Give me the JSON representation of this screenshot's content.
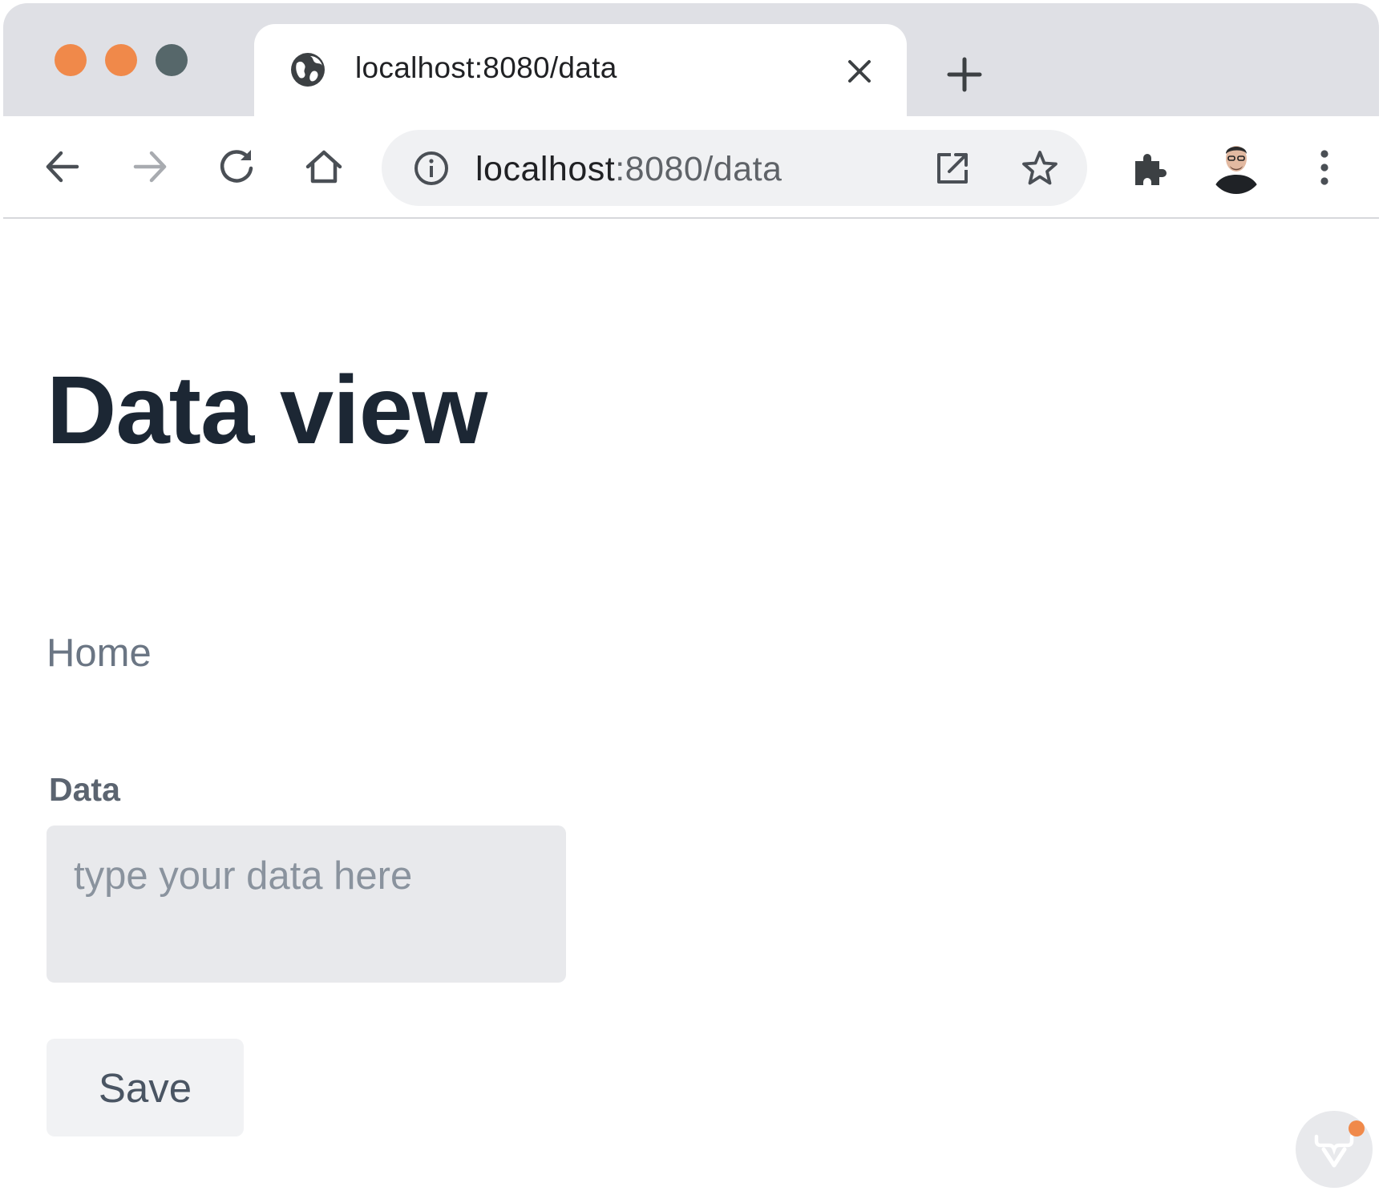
{
  "browser": {
    "traffic_lights": {
      "close_color": "#f0894a",
      "minimize_color": "#f0894a",
      "maximize_color": "#56676a"
    },
    "tab": {
      "title": "localhost:8080/data",
      "favicon": "globe-icon",
      "close_icon": "close-icon"
    },
    "new_tab_icon": "plus-icon",
    "toolbar": {
      "back_icon": "arrow-left-icon",
      "forward_icon": "arrow-right-icon",
      "reload_icon": "reload-icon",
      "home_icon": "home-icon",
      "site_info_icon": "info-icon",
      "address_host": "localhost",
      "address_rest": ":8080/data",
      "open_external_icon": "open-in-new-icon",
      "bookmark_icon": "star-icon",
      "extensions_icon": "puzzle-icon",
      "profile_icon": "avatar",
      "menu_icon": "more-vert-icon"
    }
  },
  "page": {
    "title": "Data view",
    "home_link": "Home",
    "data_field": {
      "label": "Data",
      "placeholder": "type your data here",
      "value": ""
    },
    "save_button": "Save"
  },
  "dev_badge": {
    "icon": "vaadin-icon",
    "notification_color": "#f0894a"
  },
  "colors": {
    "accent": "#f0894a",
    "title_text": "#1c2734",
    "muted_text": "#6b7684"
  }
}
